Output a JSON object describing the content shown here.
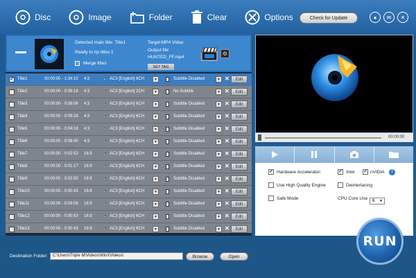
{
  "toolbar": {
    "disc": "Disc",
    "image": "Image",
    "folder": "Folder",
    "clear": "Clear",
    "options": "Options",
    "check_update": "Check for Update"
  },
  "header": {
    "detected": "Detected main title: Title1",
    "ready": "Ready to rip titles:1",
    "merge": "Merge titles",
    "target": "Target:MP4 Video",
    "output_label": "Output file:",
    "output_file": "HUNTED_FF.mp4",
    "set_tag": "SET TAG"
  },
  "titles": [
    {
      "name": "Title1",
      "time": "00:00:00 - 1:34:10",
      "aspect": "4:3",
      "audio": "AC3  [English]  6CH",
      "subtitle": "Subtitle Disabled",
      "edit": "Edit",
      "checked": true
    },
    {
      "name": "Title2",
      "time": "00:00:00 - 0:06:16",
      "aspect": "4:3",
      "audio": "AC3  [English]  2CH",
      "subtitle": "No Subtitle",
      "edit": "Edit",
      "checked": false
    },
    {
      "name": "Title3",
      "time": "00:00:00 - 0:08:06",
      "aspect": "4:3",
      "audio": "AC3  [English]  6CH",
      "subtitle": "Subtitle Disabled",
      "edit": "Edit",
      "checked": false
    },
    {
      "name": "Title4",
      "time": "00:00:00 - 0:09:28",
      "aspect": "4:3",
      "audio": "AC3  [English]  6CH",
      "subtitle": "Subtitle Disabled",
      "edit": "Edit",
      "checked": false
    },
    {
      "name": "Title5",
      "time": "00:00:00 - 0:04:18",
      "aspect": "4:3",
      "audio": "AC3  [English]  6CH",
      "subtitle": "Subtitle Disabled",
      "edit": "Edit",
      "checked": false
    },
    {
      "name": "Title6",
      "time": "00:00:00 - 0:08:40",
      "aspect": "4:3",
      "audio": "AC3  [English]  6CH",
      "subtitle": "Subtitle Disabled",
      "edit": "Edit",
      "checked": false
    },
    {
      "name": "Title7",
      "time": "00:00:00 - 0:02:53",
      "aspect": "16:9",
      "audio": "AC3  [English]  6CH",
      "subtitle": "Subtitle Disabled",
      "edit": "Edit",
      "checked": false
    },
    {
      "name": "Title8",
      "time": "00:00:00 - 0:01:17",
      "aspect": "16:9",
      "audio": "AC3  [English]  6CH",
      "subtitle": "Subtitle Disabled",
      "edit": "Edit",
      "checked": false
    },
    {
      "name": "Title9",
      "time": "00:00:00 - 0:02:50",
      "aspect": "16:9",
      "audio": "AC3  [English]  6CH",
      "subtitle": "Subtitle Disabled",
      "edit": "Edit",
      "checked": false
    },
    {
      "name": "Title10",
      "time": "00:00:00 - 0:00:43",
      "aspect": "16:9",
      "audio": "AC3  [English]  6CH",
      "subtitle": "Subtitle Disabled",
      "edit": "Edit",
      "checked": false
    },
    {
      "name": "Title11",
      "time": "00:00:00 - 0:03:08",
      "aspect": "16:9",
      "audio": "AC3  [English]  6CH",
      "subtitle": "Subtitle Disabled",
      "edit": "Edit",
      "checked": false
    },
    {
      "name": "Title12",
      "time": "00:00:00 - 0:00:53",
      "aspect": "16:9",
      "audio": "AC3  [English]  6CH",
      "subtitle": "Subtitle Disabled",
      "edit": "Edit",
      "checked": false
    },
    {
      "name": "Title13",
      "time": "00:00:00 - 0:00:43",
      "aspect": "16:9",
      "audio": "AC3  [English]  6CH",
      "subtitle": "Subtitle Disabled",
      "edit": "Edit",
      "checked": false
    }
  ],
  "destination": {
    "label": "Destination Folder:",
    "path": "C:\\Users\\Triple M\\Videos\\WinXVideos\\",
    "browse": "Browse",
    "open": "Open"
  },
  "player": {
    "time": "00:00:00"
  },
  "options": {
    "hw_label": "Hardware Accelerator:",
    "intel": "Intel",
    "nvidia": "nVIDIA",
    "high_quality": "Use High Quality Engine",
    "deinterlacing": "Deinterlacing",
    "safe_mode": "Safe Mode",
    "cpu_label": "CPU Core Use:",
    "cpu_value": "8"
  },
  "run_label": "RUN"
}
